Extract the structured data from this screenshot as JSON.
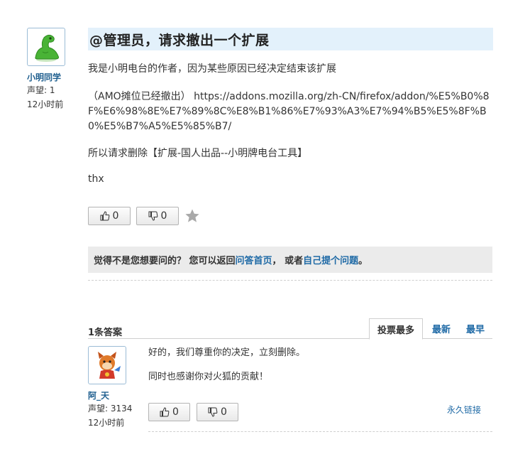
{
  "question": {
    "author": {
      "name": "小明同学",
      "reputation": "声望: 1",
      "time": "12小时前"
    },
    "title": "@管理员，请求撤出一个扩展",
    "paragraphs": [
      "我是小明电台的作者，因为某些原因已经决定结束该扩展",
      "（AMO摊位已经撤出） https://addons.mozilla.org/zh-CN/firefox/addon/%E5%B0%8F%E6%98%8E%E7%89%8C%E8%B1%86%E7%93%A3%E7%94%B5%E5%8F%B0%E5%B7%A5%E5%85%B7/",
      "所以请求删除【扩展-国人出品--小明牌电台工具】",
      "thx"
    ],
    "upvotes": "0",
    "downvotes": "0",
    "star_icon": "star-icon"
  },
  "notice": {
    "prefix": "觉得不是您想要问的？ 您可以返回",
    "link1": "问答首页",
    "middle": "， 或者",
    "link2": "自己提个问题",
    "suffix": "。"
  },
  "answers": {
    "count_label": "1条答案",
    "tabs": [
      {
        "label": "投票最多",
        "active": true
      },
      {
        "label": "最新",
        "active": false
      },
      {
        "label": "最早",
        "active": false
      }
    ],
    "items": [
      {
        "author": {
          "name": "阿_天",
          "reputation": "声望: 3134",
          "time": "12小时前"
        },
        "paragraphs": [
          "好的，我们尊重你的决定，立刻删除。",
          "同时也感谢你对火狐的贡献！"
        ],
        "upvotes": "0",
        "downvotes": "0",
        "permalink": "永久链接"
      }
    ]
  },
  "colors": {
    "link": "#1f6aa6",
    "title_bg": "#e3f1fb",
    "notice_bg": "#ebebeb"
  }
}
